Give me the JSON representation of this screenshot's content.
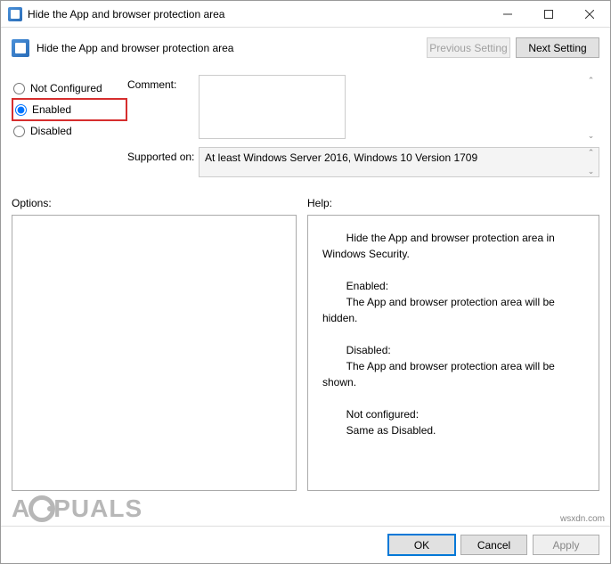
{
  "window": {
    "title": "Hide the App and browser protection area"
  },
  "toolbar": {
    "subtitle": "Hide the App and browser protection area",
    "prev": "Previous Setting",
    "next": "Next Setting"
  },
  "radios": {
    "not_configured": "Not Configured",
    "enabled": "Enabled",
    "disabled": "Disabled",
    "selected": "enabled"
  },
  "fields": {
    "comment_label": "Comment:",
    "comment_value": "",
    "supported_label": "Supported on:",
    "supported_value": "At least Windows Server 2016, Windows 10 Version 1709"
  },
  "sections": {
    "options_label": "Options:",
    "help_label": "Help:"
  },
  "help_text": "        Hide the App and browser protection area in Windows Security.\n\n        Enabled:\n        The App and browser protection area will be hidden.\n\n        Disabled:\n        The App and browser protection area will be shown.\n\n        Not configured:\n        Same as Disabled.",
  "footer": {
    "ok": "OK",
    "cancel": "Cancel",
    "apply": "Apply"
  },
  "watermark": {
    "pre": "A",
    "post": "PUALS"
  },
  "credit": "wsxdn.com"
}
